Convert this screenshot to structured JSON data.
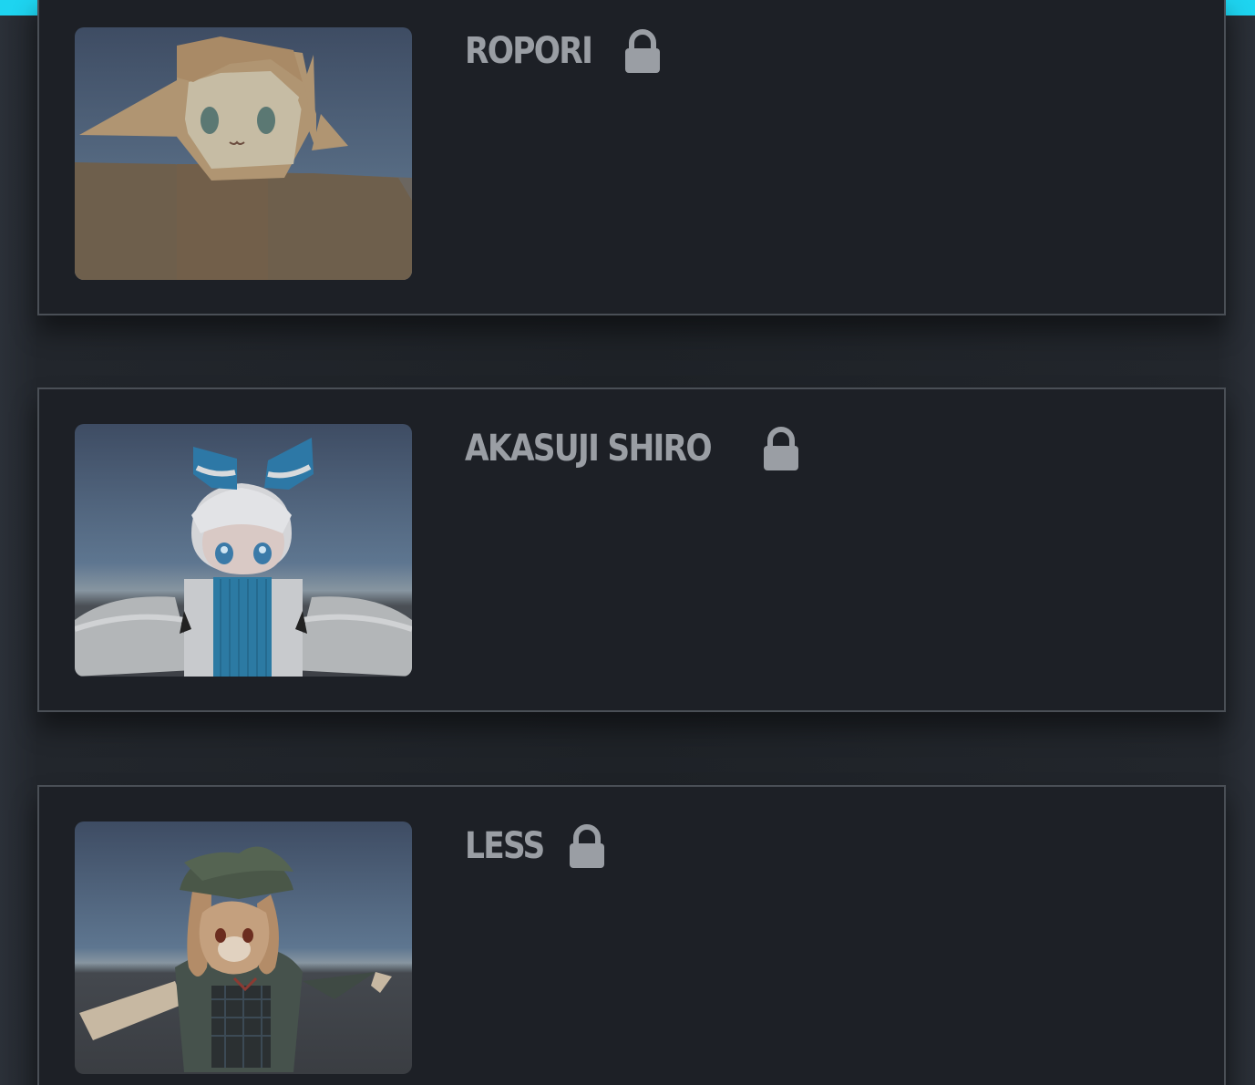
{
  "colors": {
    "accent_bar": "#1ed4f0",
    "card_bg": "#1d2026",
    "card_border": "#4a4f56",
    "title_text": "#9a9ea4"
  },
  "avatars": [
    {
      "name": "ROPORI",
      "status_icon": "lock-icon",
      "thumbnail": "ropori-thumbnail"
    },
    {
      "name": "AKASUJI SHIRO",
      "status_icon": "lock-icon",
      "thumbnail": "akasuji-shiro-thumbnail"
    },
    {
      "name": "LESS",
      "status_icon": "lock-icon",
      "thumbnail": "less-thumbnail"
    }
  ]
}
